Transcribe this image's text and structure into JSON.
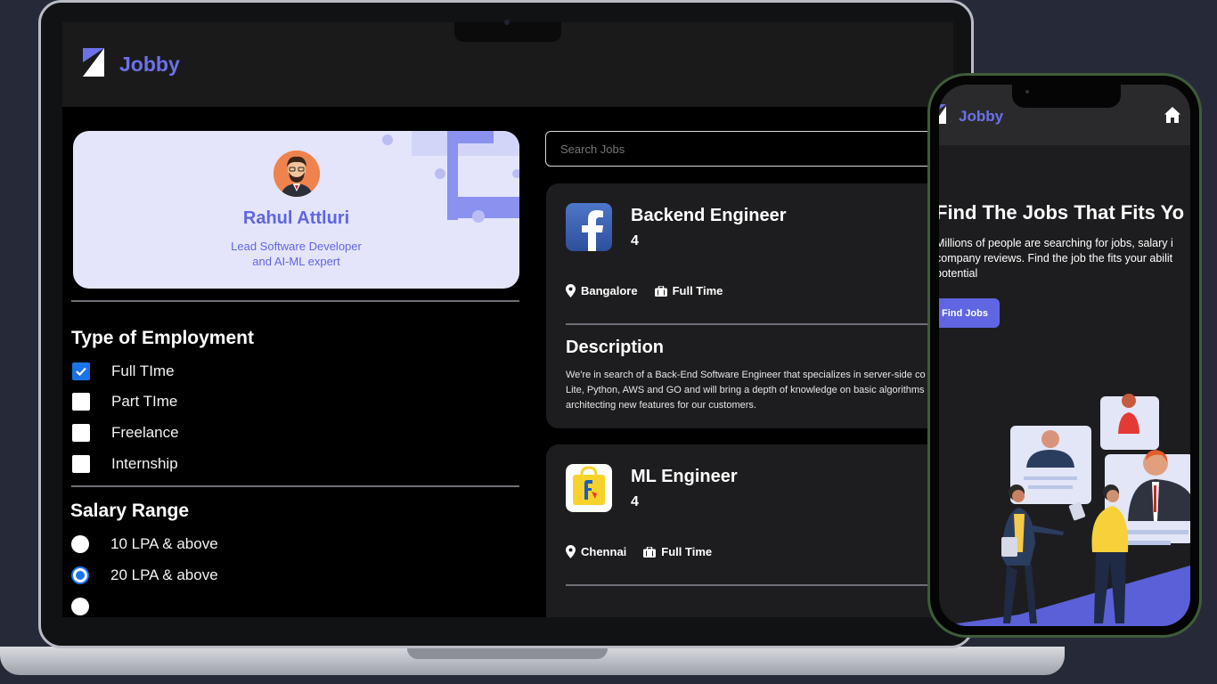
{
  "laptop": {
    "app": {
      "brand": "Jobby",
      "profile": {
        "name": "Rahul Attluri",
        "bio_line1": "Lead Software Developer",
        "bio_line2": "and AI-ML expert"
      },
      "employment": {
        "title": "Type of Employment",
        "options": [
          {
            "label": "Full TIme",
            "checked": true
          },
          {
            "label": "Part TIme",
            "checked": false
          },
          {
            "label": "Freelance",
            "checked": false
          },
          {
            "label": "Internship",
            "checked": false
          }
        ]
      },
      "salary": {
        "title": "Salary Range",
        "options": [
          {
            "label": "10 LPA & above",
            "selected": false
          },
          {
            "label": "20 LPA & above",
            "selected": true
          }
        ]
      },
      "search": {
        "placeholder": "Search Jobs"
      },
      "jobs": [
        {
          "company_logo": "facebook-logo",
          "title": "Backend Engineer",
          "rating": "4",
          "location": "Bangalore",
          "employment_type": "Full Time",
          "description_title": "Description",
          "description_lines": [
            "We're in search of a Back-End Software Engineer that specializes in server-side co",
            "Lite, Python, AWS and GO and will bring a depth of knowledge on basic algorithms",
            "architecting new features for our customers."
          ]
        },
        {
          "company_logo": "flipkart-logo",
          "title": "ML Engineer",
          "rating": "4",
          "location": "Chennai",
          "employment_type": "Full Time"
        }
      ]
    }
  },
  "phone": {
    "brand": "Jobby",
    "hero_title": "Find The Jobs That Fits Yo",
    "hero_desc_lines": [
      "Millions of people are searching for jobs, salary i",
      "company reviews. Find the job the fits your abilit",
      "potential"
    ],
    "button": "Find Jobs"
  },
  "colors": {
    "brand": "#6b72e8",
    "accent": "#6066e2",
    "background": "#262a38",
    "card": "#1d1d1f"
  }
}
